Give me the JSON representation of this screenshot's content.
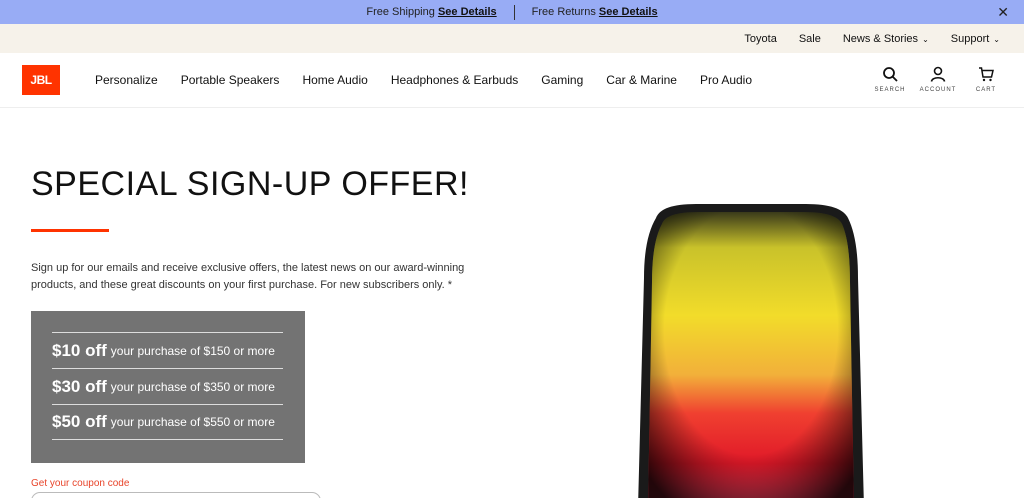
{
  "promo": {
    "shipping_text": "Free Shipping",
    "shipping_link": "See Details",
    "returns_text": "Free Returns",
    "returns_link": "See Details",
    "close_icon": "close-icon"
  },
  "utility": {
    "items": [
      {
        "label": "Toyota",
        "has_dropdown": false
      },
      {
        "label": "Sale",
        "has_dropdown": false
      },
      {
        "label": "News & Stories",
        "has_dropdown": true
      },
      {
        "label": "Support",
        "has_dropdown": true
      }
    ]
  },
  "nav": {
    "logo": "JBL",
    "menu": [
      "Personalize",
      "Portable Speakers",
      "Home Audio",
      "Headphones & Earbuds",
      "Gaming",
      "Car & Marine",
      "Pro Audio"
    ],
    "icons": {
      "search_label": "SEARCH",
      "account_label": "ACCOUNT",
      "cart_label": "CART"
    }
  },
  "hero": {
    "headline": "SPECIAL SIGN-UP OFFER!",
    "intro": "Sign up for our emails and receive exclusive offers, the latest news on our award-winning products, and these great discounts on your first purchase. For new subscribers only. *",
    "offers": [
      {
        "amount": "$10 off",
        "text": "your purchase of $150 or more"
      },
      {
        "amount": "$30 off",
        "text": "your purchase of $350 or more"
      },
      {
        "amount": "$50 off",
        "text": "your purchase of $550 or more"
      }
    ],
    "coupon_label": "Get your coupon code"
  },
  "colors": {
    "promo_bg": "#98acf5",
    "util_bg": "#f6f2ea",
    "brand_orange": "#ff3300",
    "offer_box_bg": "#737373"
  }
}
